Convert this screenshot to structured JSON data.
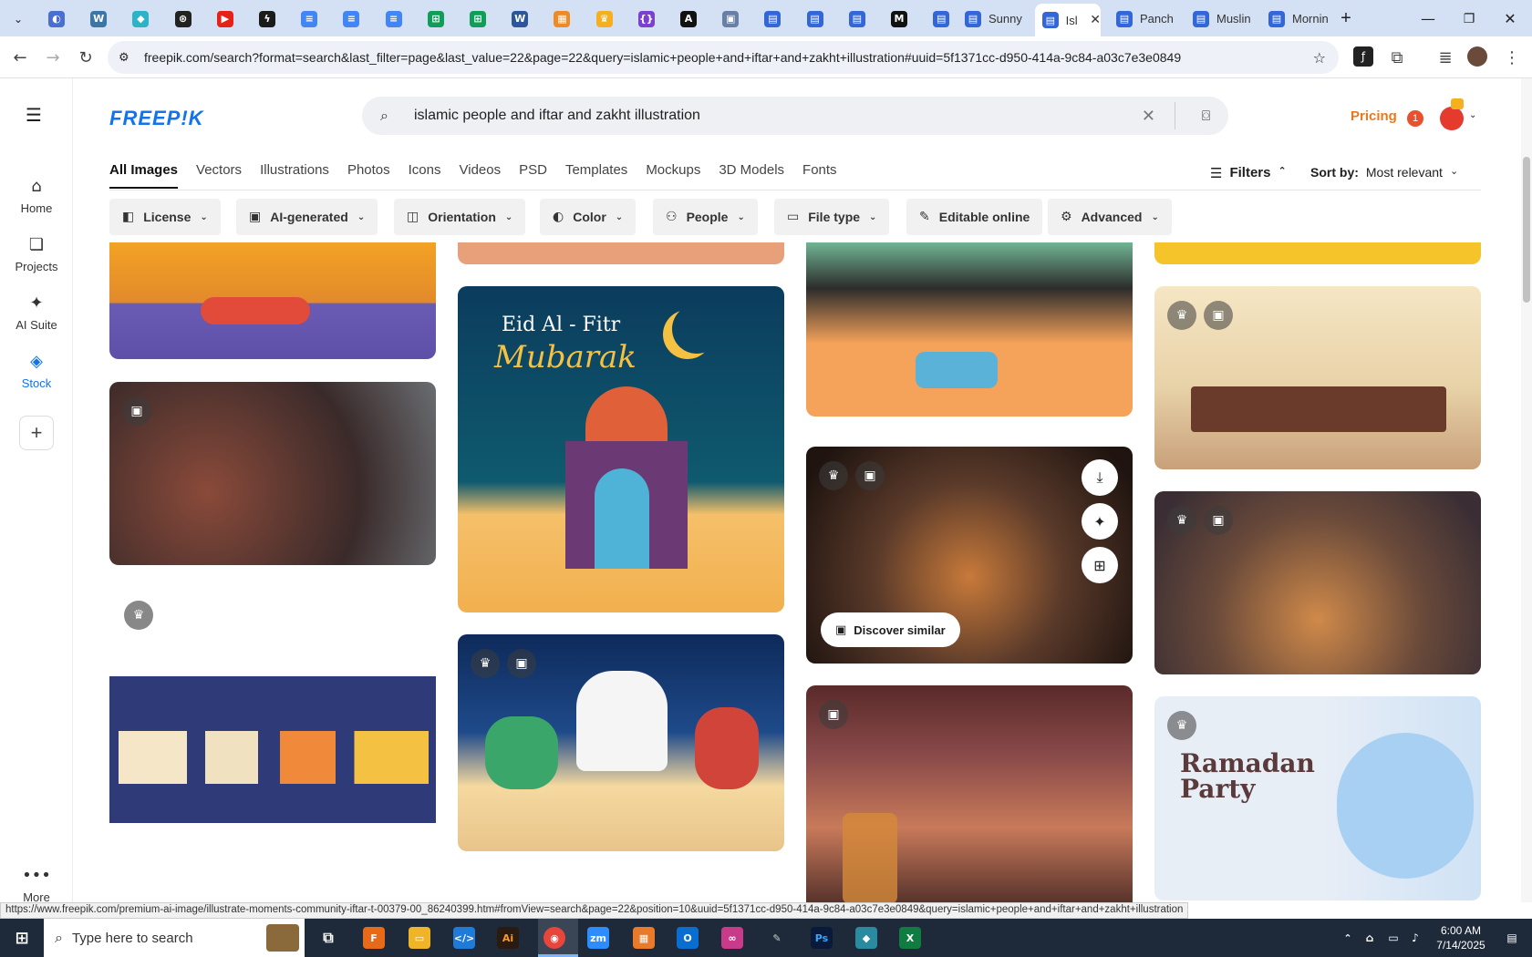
{
  "browser": {
    "tabs": [
      {
        "icon": "globe-icon",
        "color": "#4a6fd0"
      },
      {
        "icon": "wordpress-icon",
        "color": "#3a77a8"
      },
      {
        "icon": "app-icon",
        "color": "#2bb3c8"
      },
      {
        "icon": "openai-icon",
        "color": "#222"
      },
      {
        "icon": "youtube-icon",
        "color": "#e62117"
      },
      {
        "icon": "bolt-icon",
        "color": "#1b1b1b"
      },
      {
        "icon": "docs-icon",
        "color": "#4285f4"
      },
      {
        "icon": "docs-icon",
        "color": "#4285f4"
      },
      {
        "icon": "docs-icon",
        "color": "#4285f4"
      },
      {
        "icon": "sheets-icon",
        "color": "#0f9d58"
      },
      {
        "icon": "sheets-icon",
        "color": "#0f9d58"
      },
      {
        "icon": "word-icon",
        "color": "#2b579a"
      },
      {
        "icon": "grid-icon",
        "color": "#f08a24"
      },
      {
        "icon": "crown-icon",
        "color": "#f5b020"
      },
      {
        "icon": "code-icon",
        "color": "#7c3fd1"
      },
      {
        "icon": "a-icon",
        "color": "#111"
      },
      {
        "icon": "box-icon",
        "color": "#6a7fa5"
      },
      {
        "icon": "forms-icon",
        "color": "#3366d6"
      },
      {
        "icon": "forms-icon",
        "color": "#3366d6"
      },
      {
        "icon": "forms-icon",
        "color": "#3366d6"
      },
      {
        "icon": "m-icon",
        "color": "#111"
      },
      {
        "icon": "forms-icon",
        "color": "#3366d6"
      }
    ],
    "titled_tabs": [
      {
        "label": "Sunny"
      },
      {
        "label": "Isl"
      },
      {
        "label": "Panch"
      },
      {
        "label": "Muslin"
      },
      {
        "label": "Mornin"
      }
    ],
    "url": "freepik.com/search?format=search&last_filter=page&last_value=22&page=22&query=islamic+people+and+iftar+and+zakht+illustration#uuid=5f1371cc-d950-414a-9c84-a03c7e3e0849",
    "new_tab": "+"
  },
  "sidebar": {
    "items": [
      {
        "label": "Home",
        "icon": "home-icon"
      },
      {
        "label": "Projects",
        "icon": "projects-icon"
      },
      {
        "label": "AI Suite",
        "icon": "sparkle-icon"
      },
      {
        "label": "Stock",
        "icon": "stock-icon"
      }
    ],
    "more": "More"
  },
  "header": {
    "logo": "FREEP!K",
    "search_value": "islamic people and iftar and zakht illustration",
    "pricing": "Pricing",
    "notif_count": "1"
  },
  "categories": [
    "All Images",
    "Vectors",
    "Illustrations",
    "Photos",
    "Icons",
    "Videos",
    "PSD",
    "Templates",
    "Mockups",
    "3D Models",
    "Fonts"
  ],
  "filters_label": "Filters",
  "sort": {
    "label": "Sort by:",
    "value": "Most relevant"
  },
  "filter_buttons": [
    "License",
    "AI-generated",
    "Orientation",
    "Color",
    "People",
    "File type",
    "Editable online",
    "Advanced"
  ],
  "cards": {
    "eid_title": "Eid Al - Fitr",
    "eid_sub": "Mubarak",
    "ramadan": "Ramadan Party",
    "discover": "Discover similar"
  },
  "status_url": "https://www.freepik.com/premium-ai-image/illustrate-moments-community-iftar-t-00379-00_86240399.htm#fromView=search&page=22&position=10&uuid=5f1371cc-d950-414a-9c84-a03c7e3e0849&query=islamic+people+and+iftar+and+zakht+illustration",
  "taskbar": {
    "search_placeholder": "Type here to search",
    "time": "6:00 AM",
    "date": "7/14/2025"
  }
}
